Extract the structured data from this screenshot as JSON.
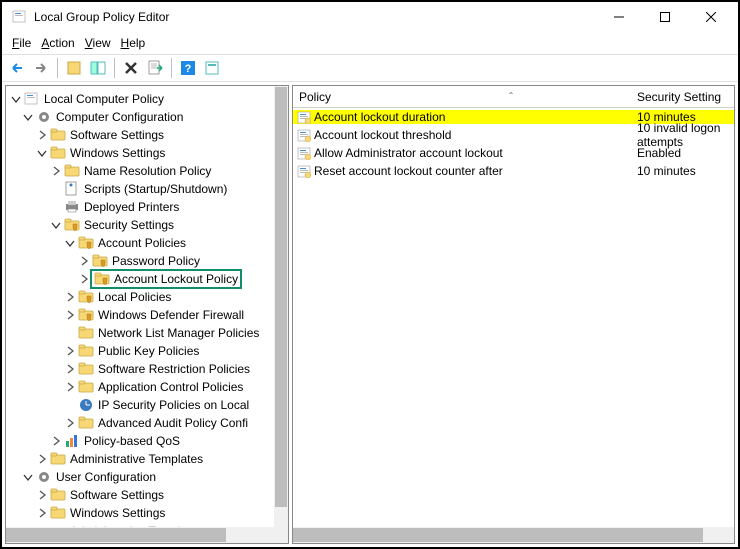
{
  "window": {
    "title": "Local Group Policy Editor"
  },
  "menu": {
    "file": "File",
    "action": "Action",
    "view": "View",
    "help": "Help"
  },
  "tree": {
    "root": "Local Computer Policy",
    "comp_config": "Computer Configuration",
    "software1": "Software Settings",
    "windows1": "Windows Settings",
    "name_res": "Name Resolution Policy",
    "scripts": "Scripts (Startup/Shutdown)",
    "printers": "Deployed Printers",
    "security": "Security Settings",
    "acct_policies": "Account Policies",
    "pw_policy": "Password Policy",
    "lockout_policy": "Account Lockout Policy",
    "local_policies": "Local Policies",
    "wdf": "Windows Defender Firewall",
    "nlmp": "Network List Manager Policies",
    "pkp": "Public Key Policies",
    "srp": "Software Restriction Policies",
    "acp": "Application Control Policies",
    "ipsec": "IP Security Policies on Local",
    "aapc": "Advanced Audit Policy Confi",
    "qos": "Policy-based QoS",
    "admin_tmpl1": "Administrative Templates",
    "user_config": "User Configuration",
    "software2": "Software Settings",
    "windows2": "Windows Settings",
    "admin_tmpl2_truncated": "Administrative Templates"
  },
  "detail": {
    "header_policy": "Policy",
    "header_setting": "Security Setting",
    "rows": [
      {
        "policy": "Account lockout duration",
        "setting": "10 minutes",
        "highlight": true
      },
      {
        "policy": "Account lockout threshold",
        "setting": "10 invalid logon attempts",
        "highlight": false
      },
      {
        "policy": "Allow Administrator account lockout",
        "setting": "Enabled",
        "highlight": false
      },
      {
        "policy": "Reset account lockout counter after",
        "setting": "10 minutes",
        "highlight": false
      }
    ]
  }
}
